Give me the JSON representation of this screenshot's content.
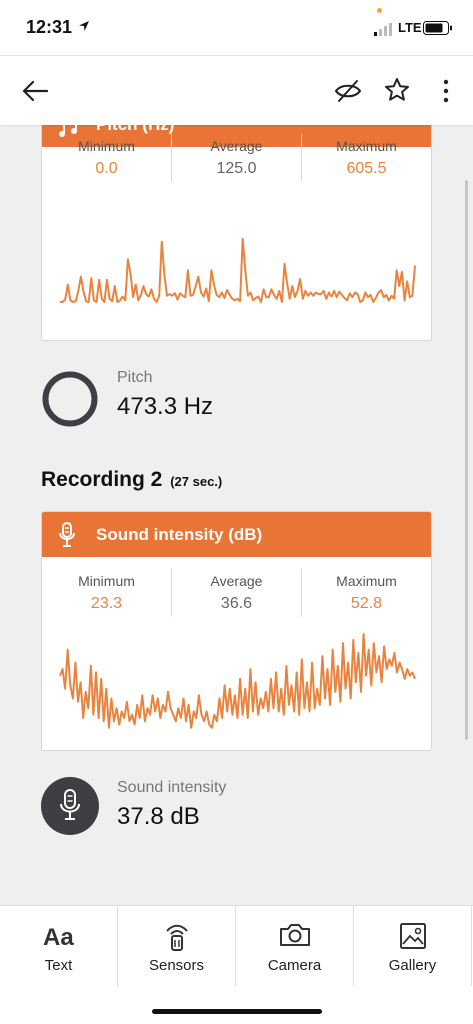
{
  "status_bar": {
    "time": "12:31",
    "network": "LTE"
  },
  "header": {
    "back_icon": "arrow-left-icon",
    "visibility_icon": "eye-off-icon",
    "favorite_icon": "star-outline-icon",
    "more_icon": "more-vertical-icon"
  },
  "pitch_card": {
    "title": "Pitch (Hz)",
    "icon": "music-note-icon",
    "stats": [
      {
        "label": "Minimum",
        "value": "0.0"
      },
      {
        "label": "Average",
        "value": "125.0"
      },
      {
        "label": "Maximum",
        "value": "605.5"
      }
    ]
  },
  "pitch_reading": {
    "icon": "circle-outline-icon",
    "label": "Pitch",
    "value": "473.3 Hz"
  },
  "recording": {
    "title": "Recording 2",
    "duration": "(27 sec.)"
  },
  "sound_card": {
    "title": "Sound intensity (dB)",
    "icon": "microphone-icon",
    "stats": [
      {
        "label": "Minimum",
        "value": "23.3"
      },
      {
        "label": "Average",
        "value": "36.6"
      },
      {
        "label": "Maximum",
        "value": "52.8"
      }
    ]
  },
  "sound_reading": {
    "icon": "microphone-icon",
    "label": "Sound intensity",
    "value": "37.8 dB"
  },
  "bottom_nav": [
    {
      "label": "Text",
      "icon": "text-icon"
    },
    {
      "label": "Sensors",
      "icon": "sensors-icon"
    },
    {
      "label": "Camera",
      "icon": "camera-icon"
    },
    {
      "label": "Gallery",
      "icon": "gallery-icon"
    }
  ],
  "colors": {
    "accent": "#e87435",
    "line": "#e8843f",
    "dark_circle": "#3d3f43"
  },
  "chart_data": [
    {
      "type": "line",
      "title": "Pitch (Hz)",
      "xlabel": "",
      "ylabel": "",
      "ylim": [
        0,
        605.5
      ],
      "grid": false,
      "series": [
        {
          "values": [
            0,
            0,
            15,
            110,
            10,
            0,
            5,
            70,
            160,
            65,
            5,
            0,
            150,
            10,
            0,
            140,
            20,
            0,
            140,
            20,
            5,
            100,
            0,
            10,
            35,
            10,
            270,
            180,
            30,
            110,
            10,
            45,
            100,
            50,
            35,
            80,
            20,
            0,
            40,
            380,
            170,
            40,
            50,
            40,
            55,
            15,
            55,
            40,
            30,
            200,
            40,
            45,
            100,
            160,
            60,
            35,
            85,
            5,
            200,
            110,
            45,
            30,
            60,
            25,
            75,
            45,
            20,
            10,
            20,
            5,
            400,
            200,
            40,
            60,
            10,
            25,
            35,
            0,
            80,
            30,
            30,
            80,
            45,
            20,
            70,
            0,
            240,
            120,
            20,
            100,
            30,
            70,
            145,
            20,
            70,
            40,
            60,
            40,
            60,
            50,
            50,
            70,
            20,
            60,
            35,
            70,
            30,
            65,
            45,
            25,
            10,
            55,
            30,
            60,
            50,
            0,
            10,
            60,
            30,
            45,
            0,
            25,
            60,
            75,
            30,
            45,
            10,
            40,
            20,
            200,
            100,
            190,
            10,
            130,
            30,
            40,
            230
          ]
        }
      ]
    },
    {
      "type": "line",
      "title": "Sound intensity (dB)",
      "xlabel": "",
      "ylabel": "",
      "ylim": [
        23.3,
        52.8
      ],
      "grid": false,
      "series": [
        {
          "values": [
            40,
            42,
            36,
            48,
            37,
            33,
            44,
            32,
            38,
            27,
            35,
            30,
            43,
            28,
            41,
            27,
            39,
            26,
            36,
            24,
            33,
            26,
            30,
            25,
            29,
            27,
            32,
            26,
            28,
            25,
            31,
            27,
            34,
            26,
            30,
            28,
            34,
            29,
            33,
            27,
            31,
            29,
            35,
            30,
            28,
            26,
            30,
            27,
            33,
            26,
            31,
            24,
            29,
            27,
            34,
            28,
            26,
            29,
            25,
            24,
            28,
            26,
            33,
            27,
            37,
            29,
            36,
            28,
            34,
            27,
            39,
            28,
            36,
            27,
            42,
            29,
            38,
            28,
            33,
            30,
            35,
            29,
            39,
            30,
            41,
            29,
            36,
            28,
            43,
            31,
            37,
            29,
            41,
            28,
            45,
            30,
            38,
            29,
            44,
            30,
            36,
            31,
            46,
            33,
            42,
            31,
            48,
            35,
            43,
            32,
            50,
            36,
            44,
            33,
            51,
            38,
            47,
            35,
            52.8,
            40,
            48,
            37,
            50,
            41,
            46,
            38,
            49,
            42,
            45,
            43,
            47,
            41,
            44,
            42,
            39,
            42,
            40,
            41,
            39
          ]
        }
      ]
    }
  ]
}
